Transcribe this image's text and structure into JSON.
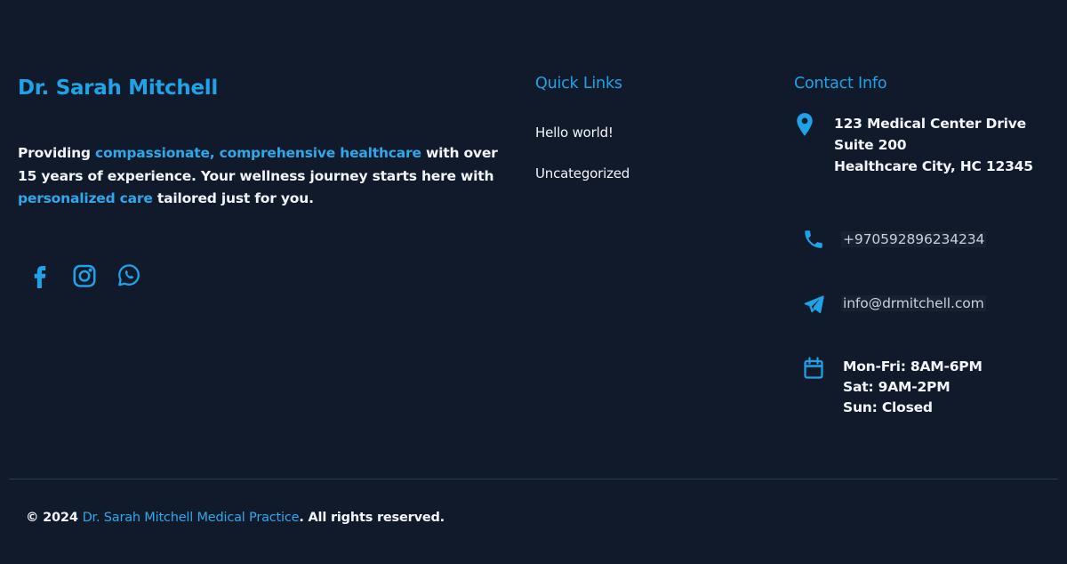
{
  "brand": {
    "name": "Dr. Sarah Mitchell"
  },
  "about": {
    "text_1": "Providing ",
    "highlight_1": "compassionate, comprehensive healthcare",
    "text_2": " with over 15 years of experience. Your wellness journey starts here with ",
    "highlight_2": "personalized care",
    "text_3": " tailored just for you."
  },
  "social": {
    "icons": [
      "facebook-icon",
      "instagram-icon",
      "whatsapp-icon"
    ]
  },
  "quick_links": {
    "title": "Quick Links",
    "items": [
      {
        "label": "Hello world!"
      },
      {
        "label": "Uncategorized"
      }
    ]
  },
  "contact": {
    "title": "Contact Info",
    "address": {
      "line1": "123 Medical Center Drive",
      "line2": "Suite 200",
      "line3": "Healthcare City, HC 12345"
    },
    "phone": "+970592896234234",
    "email": "info@drmitchell.com",
    "hours": {
      "line1": "Mon-Fri: 8AM-6PM",
      "line2": "Sat: 9AM-2PM",
      "line3": "Sun: Closed"
    }
  },
  "footer": {
    "copyright_prefix": "© 2024 ",
    "copyright_name": "Dr. Sarah Mitchell Medical Practice",
    "copyright_suffix": ". All rights reserved."
  },
  "colors": {
    "background": "#111a2b",
    "accent": "#1fa3e6",
    "text": "#f1f5f9",
    "divider": "#2b3a4f"
  }
}
